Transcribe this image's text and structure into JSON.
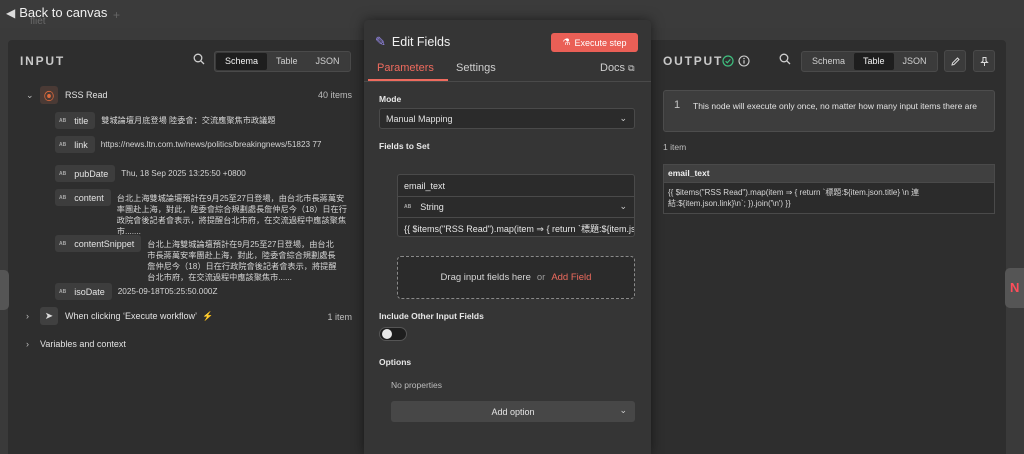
{
  "topbar": {
    "back_label": "Back to canvas",
    "ghost_tab": "fliet",
    "ghost_plus": "+"
  },
  "input_panel": {
    "title": "INPUT",
    "view_tabs": [
      "Schema",
      "Table",
      "JSON"
    ],
    "active_view": "Schema",
    "rss_node": {
      "name": "RSS Read",
      "count": "40 items"
    },
    "fields": [
      {
        "name": "title",
        "value": "雙城論壇月底登場 陸委會：交流應聚焦市政議題"
      },
      {
        "name": "link",
        "value": "https://news.ltn.com.tw/news/politics/breakingnews/51823 77"
      },
      {
        "name": "pubDate",
        "value": "Thu, 18 Sep 2025 13:25:50 +0800"
      },
      {
        "name": "content",
        "value": "台北上海雙城論壇預計在9月25至27日登場，由台北市長蔣萬安率團赴上海，對此，陸委會綜合規劃處長詹仲尼今（18）日在行政院會後記者會表示，將提醒台北市府，在交流過程中應該聚焦市......."
      },
      {
        "name": "contentSnippet",
        "value": "台北上海雙城論壇預計在9月25至27日登場，由台北市長蔣萬安率團赴上海，對此，陸委會綜合規劃處長詹仲尼今（18）日在行政院會後記者會表示，將提醒台北市府，在交流過程中應該聚焦市......"
      },
      {
        "name": "isoDate",
        "value": "2025-09-18T05:25:50.000Z"
      }
    ],
    "trigger_node": {
      "name": "When clicking ‘Execute workflow’",
      "count": "1 item"
    },
    "variables_label": "Variables and context",
    "type_badge": "AB"
  },
  "modal": {
    "title": "Edit Fields",
    "execute_label": "Execute step",
    "tabs": {
      "parameters": "Parameters",
      "settings": "Settings",
      "docs": "Docs"
    },
    "mode_label": "Mode",
    "mode_value": "Manual Mapping",
    "fields_label": "Fields to Set",
    "field_name": "email_text",
    "field_type": "String",
    "field_value": "{{ $items(\"RSS Read\").map(item ⇒ {        return `標題:${item.json.title} \\n 連結:${item.json.link}\\n`; }).join('\\n') }}",
    "drop_text": "Drag input fields here",
    "drop_or": "or",
    "drop_add": "Add Field",
    "include_label": "Include Other Input Fields",
    "include_other": false,
    "options_label": "Options",
    "no_props": "No properties",
    "add_option": "Add option"
  },
  "output_panel": {
    "title": "OUTPUT",
    "view_tabs": [
      "Schema",
      "Table",
      "JSON"
    ],
    "active_view": "Table",
    "notice_num": "1",
    "notice_text": "This node will execute only once, no matter how many input items there are",
    "items_count": "1 item",
    "column": "email_text",
    "cell": "{{ $items(\"RSS Read\").map(item ⇒ {        return `標題:${item.json.title} \\n 連結:${item.json.link}\\n`; }).join('\\n') }}"
  },
  "colors": {
    "accent": "#ea5f56",
    "tab_active": "#ef6b5e",
    "pencil": "#9a8cf2",
    "success": "#3fbf7f"
  },
  "icons": [
    "search-icon",
    "pencil-icon",
    "pin-icon",
    "check-circle-icon",
    "info-icon",
    "flask-icon",
    "external-link-icon",
    "rss-icon",
    "mouse-pointer-icon",
    "chevron-down-icon",
    "chevron-right-icon",
    "lightning-icon"
  ]
}
